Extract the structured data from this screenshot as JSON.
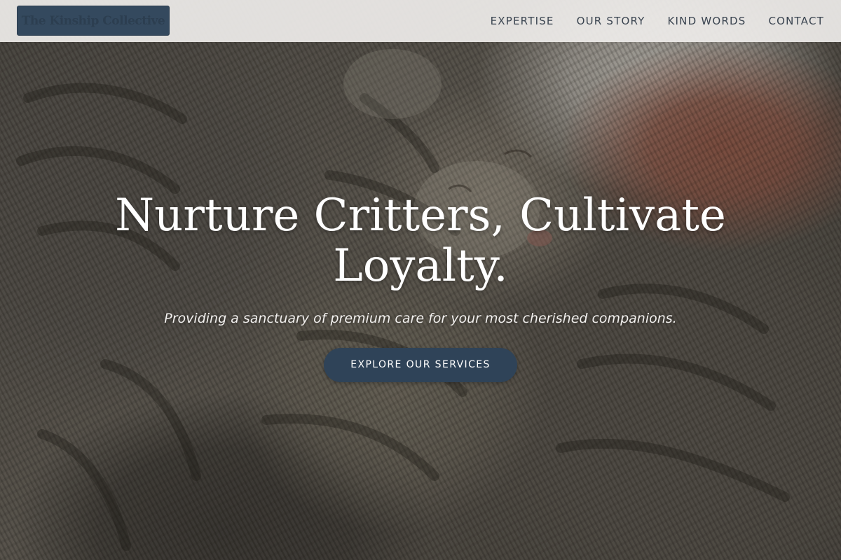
{
  "header": {
    "logo_text": "The Kinship Collective",
    "nav": [
      {
        "label": "EXPERTISE"
      },
      {
        "label": "OUR STORY"
      },
      {
        "label": "KIND WORDS"
      },
      {
        "label": "CONTACT"
      }
    ]
  },
  "hero": {
    "title": "Nurture Critters, Cultivate Loyalty.",
    "subtitle": "Providing a sanctuary of premium care for your most cherished companions.",
    "cta_label": "EXPLORE OUR SERVICES",
    "background_image": "two-tabby-cats-cuddling-photo"
  },
  "colors": {
    "brand_navy": "#2f4358",
    "header_bg": "#eeecea",
    "nav_text": "#3a4450"
  }
}
